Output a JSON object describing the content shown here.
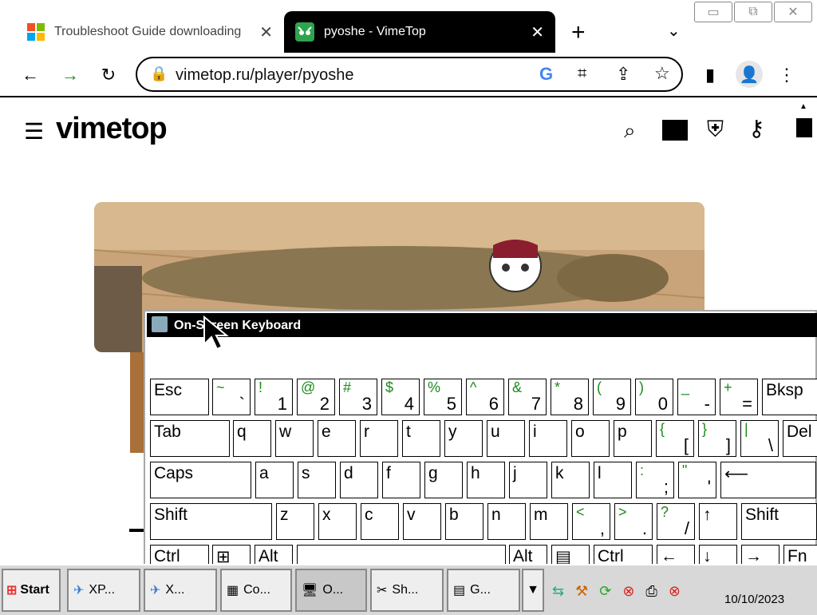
{
  "browser": {
    "tabs": [
      {
        "title": "Troubleshoot Guide downloading",
        "active": false
      },
      {
        "title": "pyoshe - VimeTop",
        "active": true
      }
    ],
    "url": "vimetop.ru/player/pyoshe"
  },
  "site": {
    "logo": "vimetop"
  },
  "osk": {
    "title": "On-Screen Keyboard",
    "rows": [
      [
        {
          "l": "Esc"
        },
        {
          "s": "~",
          "m": "`"
        },
        {
          "s": "!",
          "m": "1"
        },
        {
          "s": "@",
          "m": "2"
        },
        {
          "s": "#",
          "m": "3"
        },
        {
          "s": "$",
          "m": "4"
        },
        {
          "s": "%",
          "m": "5"
        },
        {
          "s": "^",
          "m": "6"
        },
        {
          "s": "&",
          "m": "7"
        },
        {
          "s": "*",
          "m": "8"
        },
        {
          "s": "(",
          "m": "9"
        },
        {
          "s": ")",
          "m": "0"
        },
        {
          "s": "_",
          "m": "-"
        },
        {
          "s": "+",
          "m": "="
        },
        {
          "l": "Bksp"
        }
      ],
      [
        {
          "l": "Tab"
        },
        {
          "l": "q"
        },
        {
          "l": "w"
        },
        {
          "l": "e"
        },
        {
          "l": "r"
        },
        {
          "l": "t"
        },
        {
          "l": "y"
        },
        {
          "l": "u"
        },
        {
          "l": "i"
        },
        {
          "l": "o"
        },
        {
          "l": "p"
        },
        {
          "s": "{",
          "m": "["
        },
        {
          "s": "}",
          "m": "]"
        },
        {
          "s": "|",
          "m": "\\"
        },
        {
          "l": "Del"
        }
      ],
      [
        {
          "l": "Caps"
        },
        {
          "l": "a"
        },
        {
          "l": "s"
        },
        {
          "l": "d"
        },
        {
          "l": "f"
        },
        {
          "l": "g"
        },
        {
          "l": "h"
        },
        {
          "l": "j"
        },
        {
          "l": "k"
        },
        {
          "l": "l"
        },
        {
          "s": ":",
          "m": ";"
        },
        {
          "s": "\"",
          "m": "'"
        },
        {
          "l": "⟵"
        }
      ],
      [
        {
          "l": "Shift"
        },
        {
          "l": "z"
        },
        {
          "l": "x"
        },
        {
          "l": "c"
        },
        {
          "l": "v"
        },
        {
          "l": "b"
        },
        {
          "l": "n"
        },
        {
          "l": "m"
        },
        {
          "s": "<",
          "m": ","
        },
        {
          "s": ">",
          "m": "."
        },
        {
          "s": "?",
          "m": "/"
        },
        {
          "l": "↑"
        },
        {
          "l": "Shift"
        }
      ],
      [
        {
          "l": "Ctrl"
        },
        {
          "l": "⊞"
        },
        {
          "l": "Alt"
        },
        {
          "l": ""
        },
        {
          "l": "Alt"
        },
        {
          "l": "▤"
        },
        {
          "l": "Ctrl"
        },
        {
          "l": "←"
        },
        {
          "l": "↓"
        },
        {
          "l": "→"
        },
        {
          "l": "Fn"
        }
      ]
    ]
  },
  "taskbar": {
    "start": "Start",
    "buttons": [
      "XP...",
      "X...",
      "Co...",
      "O...",
      "Sh...",
      "G..."
    ],
    "date": "10/10/2023"
  }
}
